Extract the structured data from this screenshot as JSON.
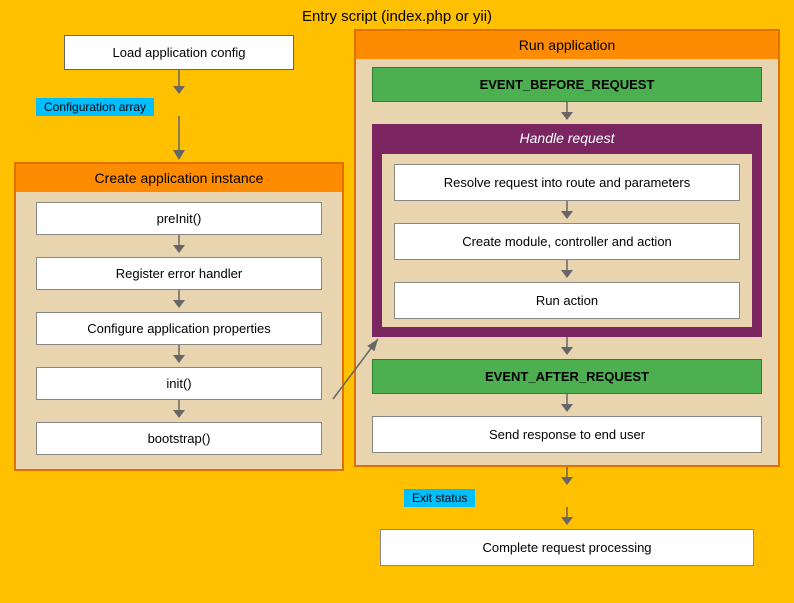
{
  "title": "Entry script (index.php or yii)",
  "left": {
    "load_config": "Load application config",
    "config_label": "Configuration array",
    "create_section_title": "Create application instance",
    "flow_items": [
      "preInit()",
      "Register error handler",
      "Configure application properties",
      "init()",
      "bootstrap()"
    ]
  },
  "right": {
    "run_section_title": "Run application",
    "event_before": "EVENT_BEFORE_REQUEST",
    "handle_request_title": "Handle request",
    "handle_items": [
      "Resolve request into route and parameters",
      "Create module, controller and action",
      "Run action"
    ],
    "event_after": "EVENT_AFTER_REQUEST",
    "send_response": "Send response to end user",
    "exit_label": "Exit status",
    "complete": "Complete request processing"
  },
  "colors": {
    "background": "#FFC000",
    "orange_header": "#FF8C00",
    "section_bg": "#E8D5B0",
    "green_event": "#4CAF50",
    "purple_handle": "#7B2560",
    "cyan_label": "#00BFFF",
    "arrow_color": "#666666"
  }
}
